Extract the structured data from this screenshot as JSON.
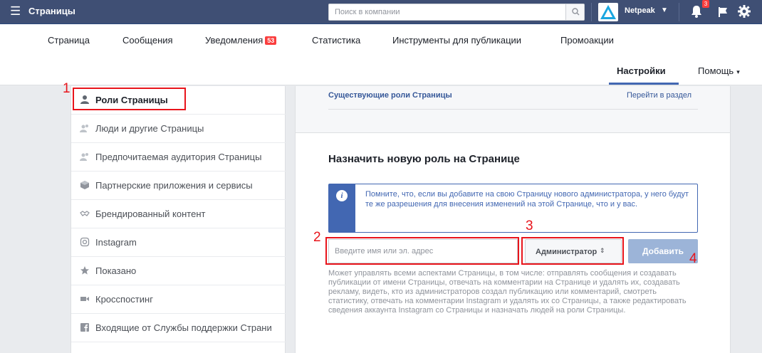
{
  "topbar": {
    "menu_icon": "hamburger-icon",
    "title": "Страницы",
    "search_placeholder": "Поиск в компании",
    "account_name": "Netpeak",
    "notifications_count": "3"
  },
  "nav": {
    "tabs": [
      {
        "label": "Страница"
      },
      {
        "label": "Сообщения"
      },
      {
        "label": "Уведомления",
        "count": "53"
      },
      {
        "label": "Статистика"
      },
      {
        "label": "Инструменты для публикации"
      },
      {
        "label": "Промоакции"
      }
    ],
    "settings": "Настройки",
    "help": "Помощь",
    "help_caret": "▾"
  },
  "sidebar": {
    "items": [
      {
        "label": "Роли Страницы",
        "icon": "person-icon"
      },
      {
        "label": "Люди и другие Страницы",
        "icon": "people-icon"
      },
      {
        "label": "Предпочитаемая аудитория Страницы",
        "icon": "audience-icon"
      },
      {
        "label": "Партнерские приложения и сервисы",
        "icon": "cube-icon"
      },
      {
        "label": "Брендированный контент",
        "icon": "handshake-icon"
      },
      {
        "label": "Instagram",
        "icon": "instagram-icon"
      },
      {
        "label": "Показано",
        "icon": "star-icon"
      },
      {
        "label": "Кросспостинг",
        "icon": "video-camera-icon"
      },
      {
        "label": "Входящие от Службы поддержки Страни",
        "icon": "facebook-icon"
      }
    ]
  },
  "main": {
    "existing_roles_title": "Существующие роли Страницы",
    "goto_section": "Перейти в раздел",
    "assign_title": "Назначить новую роль на Странице",
    "info_text": "Помните, что, если вы добавите на свою Страницу нового администратора, у него будут те же разрешения для внесения изменений на этой Странице, что и у вас.",
    "name_placeholder": "Введите имя или эл. адрес",
    "role_value": "Администратор",
    "role_arrow": "⇕",
    "add_button": "Добавить",
    "role_description": "Может управлять всеми аспектами Страницы, в том числе: отправлять сообщения и создавать публикации от имени Страницы, отвечать на комментарии на Странице и удалять их, создавать рекламу, видеть, кто из администраторов создал публикацию или комментарий, смотреть статистику, отвечать на комментарии Instagram и удалять их со Страницы, а также редактировать сведения аккаунта Instagram со Страницы и назначать людей на роли Страницы."
  },
  "annotations": {
    "n1": "1",
    "n2": "2",
    "n3": "3",
    "n4": "4",
    "color": "#e8141b"
  },
  "colors": {
    "topbar": "#3f4f74",
    "accent": "#4267b2",
    "link": "#365899",
    "add_button_disabled": "#9cb4d8"
  }
}
